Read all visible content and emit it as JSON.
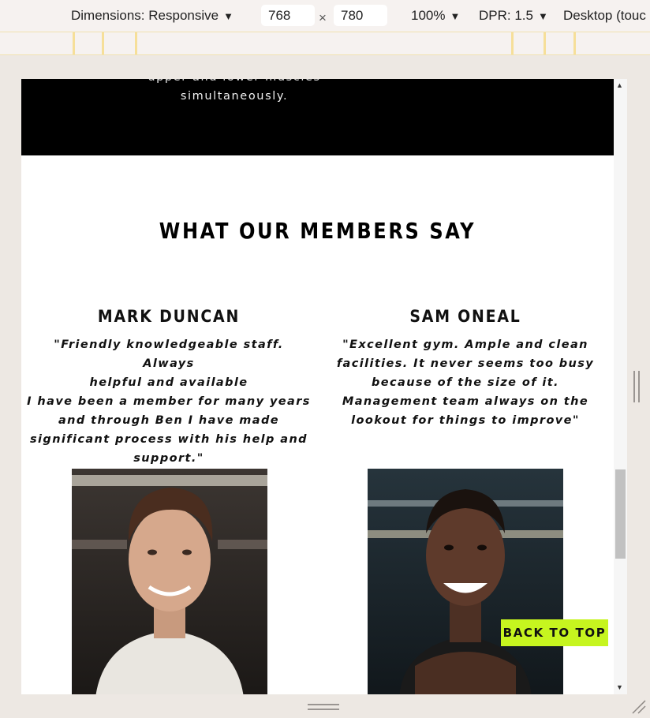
{
  "devtools": {
    "dimensions_label": "Dimensions: Responsive",
    "width_value": "768",
    "height_value": "780",
    "times_symbol": "×",
    "zoom_label": "100%",
    "dpr_label": "DPR: 1.5",
    "device_label": "Desktop (touc"
  },
  "hero": {
    "lines": [
      "upper and lower muscles",
      "simultaneously."
    ]
  },
  "testimonials": {
    "title": "WHAT OUR MEMBERS SAY",
    "members": [
      {
        "name": "MARK DUNCAN",
        "quote_lines": [
          "\"Friendly knowledgeable staff. Always",
          "helpful and available",
          "I have been a member for many years",
          "and through Ben I have made",
          "significant process with his help and",
          "support.\""
        ]
      },
      {
        "name": "SAM ONEAL",
        "quote_lines": [
          "\"Excellent gym. Ample and clean",
          "facilities. It never seems too busy",
          "because of the size of it.",
          "Management team always on the",
          "lookout for things to improve\""
        ]
      }
    ]
  },
  "back_to_top": "BACK TO TOP"
}
